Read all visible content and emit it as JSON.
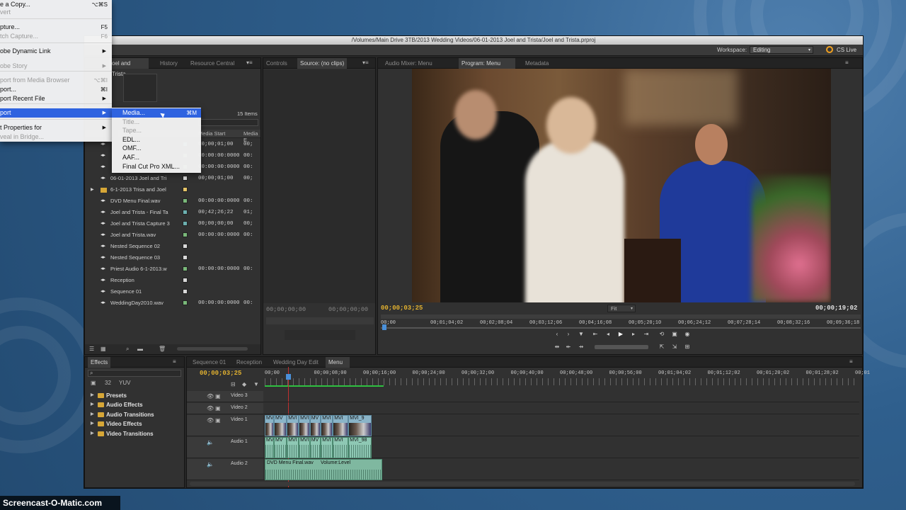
{
  "window": {
    "title": "/Volumes/Main Drive 3TB/2013 Wedding Videos/06-01-2013 Joel and Trista/Joel and Trista.prproj"
  },
  "appbar": {
    "workspace_label": "Workspace:",
    "workspace_value": "Editing",
    "cs_live": "CS Live"
  },
  "file_menu": {
    "items": [
      {
        "label": "e a Copy...",
        "shortcut": "⌥⌘S"
      },
      {
        "label": "vert",
        "disabled": true
      },
      {
        "label": "pture...",
        "shortcut": "F5"
      },
      {
        "label": "tch Capture...",
        "shortcut": "F6",
        "disabled": true
      },
      {
        "label": "obe Dynamic Link",
        "submenu": true
      },
      {
        "label": "obe Story",
        "submenu": true,
        "disabled": true
      },
      {
        "label": "port from Media Browser",
        "shortcut": "⌥⌘I",
        "disabled": true
      },
      {
        "label": "port...",
        "shortcut": "⌘I"
      },
      {
        "label": "port Recent File",
        "submenu": true
      },
      {
        "label": "port",
        "submenu": true
      },
      {
        "label": "t Properties for",
        "submenu": true
      },
      {
        "label": "veal in Bridge...",
        "disabled": true
      }
    ]
  },
  "export_submenu": {
    "items": [
      {
        "label": "Media...",
        "shortcut": "⌘M"
      },
      {
        "label": "Title...",
        "disabled": true
      },
      {
        "label": "Tape...",
        "disabled": true
      },
      {
        "label": "EDL..."
      },
      {
        "label": "OMF..."
      },
      {
        "label": "AAF..."
      },
      {
        "label": "Final Cut Pro XML..."
      }
    ]
  },
  "project_panel": {
    "tabs": [
      "oel and Trista",
      "History",
      "Resource Central"
    ],
    "item_count": "15 Items",
    "col_media_start": "Media Start",
    "col_media_end": "Media E",
    "rows": [
      {
        "name": "",
        "start": "00;00;01;00",
        "end": "00;",
        "color": "#6cb0b0"
      },
      {
        "name": "",
        "start": "00:00:00:0000",
        "end": "00:",
        "color": "#79b879"
      },
      {
        "name": "",
        "start": "00:00:00:0000",
        "end": "00:",
        "color": "#79b879"
      },
      {
        "name": "06-01-2013 Joel and Tri",
        "start": "00;00;01;00",
        "end": "00;",
        "color": "#d9d9d9"
      },
      {
        "name": "6-1-2013 Trisa and Joel",
        "start": "",
        "end": "",
        "color": "#e6c567",
        "folder": true
      },
      {
        "name": "DVD Menu Final.wav",
        "start": "00:00:00:0000",
        "end": "00:",
        "color": "#79b879"
      },
      {
        "name": "Joel and Trista - Final Ta",
        "start": "00;42;26;22",
        "end": "01;",
        "color": "#6cb0b0"
      },
      {
        "name": "Joel and Trista Capture 3",
        "start": "00;00;00;00",
        "end": "00;",
        "color": "#6cb0b0"
      },
      {
        "name": "Joel and Trista.wav",
        "start": "00:00:00:0000",
        "end": "00:",
        "color": "#79b879"
      },
      {
        "name": "Nested Sequence 02",
        "start": "",
        "end": "",
        "color": "#d9d9d9"
      },
      {
        "name": "Nested Sequence 03",
        "start": "",
        "end": "",
        "color": "#d9d9d9"
      },
      {
        "name": "Priest Audio 6-1-2013.w",
        "start": "00:00:00:0000",
        "end": "00:",
        "color": "#79b879"
      },
      {
        "name": "Reception",
        "start": "",
        "end": "",
        "color": "#d9d9d9"
      },
      {
        "name": "Sequence 01",
        "start": "",
        "end": "",
        "color": "#d9d9d9"
      },
      {
        "name": "WeddingDay2010.wav",
        "start": "00:00:00:0000",
        "end": "00:",
        "color": "#79b879"
      }
    ]
  },
  "source_monitor": {
    "tabs": [
      "Controls",
      "Source: (no clips)"
    ],
    "timecode_left": "00;00;00;00",
    "timecode_right": "00;00;00;00"
  },
  "program_monitor": {
    "tabs": [
      "Audio Mixer: Menu",
      "Program: Menu",
      "Metadata"
    ],
    "timecode_current": "00;00;03;25",
    "timecode_duration": "00;00;19;02",
    "fit": "Fit",
    "ruler": [
      "00;00",
      "00;01;04;02",
      "00;02;08;04",
      "00;03;12;06",
      "00;04;16;08",
      "00;05;20;10",
      "00;06;24;12",
      "00;07;28;14",
      "00;08;32;16",
      "00;09;36;18"
    ]
  },
  "effects_panel": {
    "tab": "Effects",
    "folders": [
      "Presets",
      "Audio Effects",
      "Audio Transitions",
      "Video Effects",
      "Video Transitions"
    ]
  },
  "timeline": {
    "tabs": [
      "Sequence 01",
      "Reception",
      "Wedding Day Edit",
      "Menu"
    ],
    "timecode": "00;00;03;25",
    "ruler": [
      "00;00",
      "00;00;08;00",
      "00;00;16;00",
      "00;00;24;00",
      "00;00;32;00",
      "00;00;40;00",
      "00;00;48;00",
      "00;00;56;00",
      "00;01;04;02",
      "00;01;12;02",
      "00;01;20;02",
      "00;01;28;02",
      "00;01"
    ],
    "tracks": {
      "v3": "Video 3",
      "v2": "Video 2",
      "v1": "Video 1",
      "a1": "Audio 1",
      "a2": "Audio 2"
    },
    "video_clip_labels": [
      "MV",
      "MV",
      "MVI",
      "MVI",
      "MV",
      "MVI",
      "MVI",
      "MVI_9"
    ],
    "audio1_clip_labels": [
      "MVI",
      "MV",
      "MVI",
      "MVI",
      "MV",
      "MVI",
      "MVI",
      "MVI_98"
    ],
    "audio2_clip_label": "DVD Menu Final.wav",
    "audio2_volume_label": "Volume:Level"
  },
  "watermark": "Screencast-O-Matic.com"
}
